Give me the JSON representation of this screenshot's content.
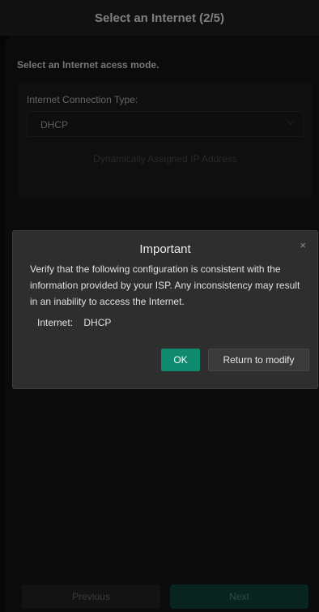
{
  "header": {
    "title": "Select an Internet (2/5)"
  },
  "main": {
    "subtitle": "Select an Internet acess mode.",
    "connection_type": {
      "label": "Internet Connection Type:",
      "selected": "DHCP",
      "caret_icon": "chevron-down-icon",
      "helper": "Dynamically Assigned IP Address"
    }
  },
  "footer": {
    "previous_label": "Previous",
    "next_label": "Next"
  },
  "modal": {
    "title": "Important",
    "close_icon": "close-icon",
    "close_glyph": "×",
    "message": "Verify that the following configuration is consistent with the information provided by your ISP. Any inconsistency may result in an inability to access the Internet.",
    "summary_label": "Internet:",
    "summary_value": "DHCP",
    "ok_label": "OK",
    "return_label": "Return to modify"
  },
  "colors": {
    "accent": "#0f8a6e",
    "header_bg": "#202020",
    "modal_bg": "#2e2e2e"
  }
}
